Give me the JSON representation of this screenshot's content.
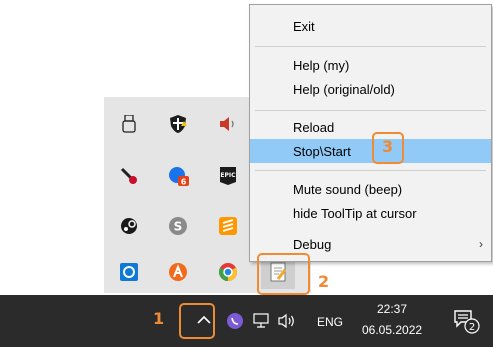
{
  "context_menu": {
    "items": [
      {
        "label": "Exit"
      },
      {
        "label": "Help (my)"
      },
      {
        "label": "Help (original/old)"
      },
      {
        "label": "Reload"
      },
      {
        "label": "Stop\\Start"
      },
      {
        "label": "Mute sound (beep)"
      },
      {
        "label": "hide ToolTip at cursor"
      },
      {
        "label": "Debug"
      }
    ],
    "submenu_arrow": "›",
    "highlight_color": "#91c9f7"
  },
  "tray_overflow": {
    "icons": [
      {
        "name": "usb-drive-icon"
      },
      {
        "name": "security-shield-icon"
      },
      {
        "name": "volume-mixer-icon"
      },
      {
        "name": "pencil-app-icon"
      },
      {
        "name": "chrome-canary-icon",
        "badge": "6"
      },
      {
        "name": "epic-games-icon",
        "text": "EPIC"
      },
      {
        "name": "steam-icon"
      },
      {
        "name": "skype-icon",
        "text": "S"
      },
      {
        "name": "sublime-icon"
      },
      {
        "name": "onedrive-icon"
      },
      {
        "name": "avast-icon"
      },
      {
        "name": "chrome-icon"
      },
      {
        "name": "autohotkey-script-icon"
      }
    ]
  },
  "taskbar": {
    "language": "ENG",
    "time": "22:37",
    "date": "06.05.2022",
    "notification_count": "2",
    "background": "#2b2b2b"
  },
  "callouts": {
    "one": "1",
    "two": "2",
    "three": "3",
    "color": "#ef8b34"
  }
}
